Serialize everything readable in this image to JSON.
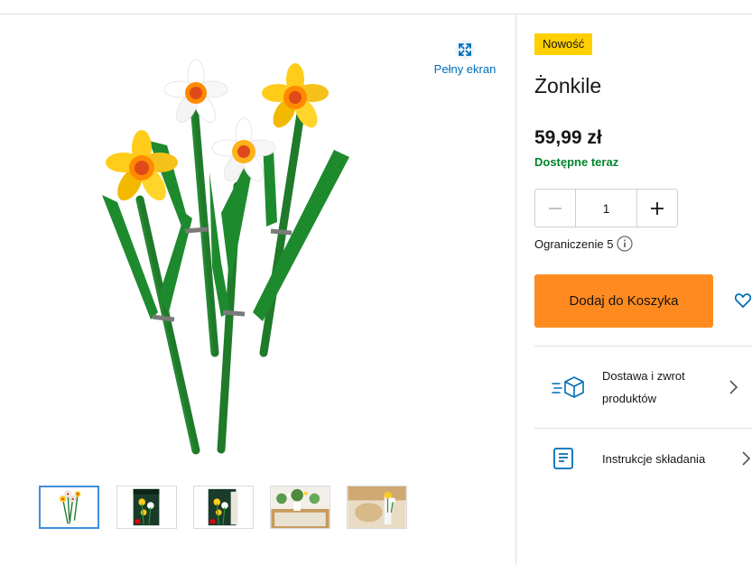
{
  "gallery": {
    "fullscreen_label": "Pełny ekran",
    "thumbnails": [
      {
        "name": "thumbnail-flowers",
        "active": true
      },
      {
        "name": "thumbnail-box-front",
        "active": false
      },
      {
        "name": "thumbnail-box-angle",
        "active": false
      },
      {
        "name": "thumbnail-shelf-scene",
        "active": false
      },
      {
        "name": "thumbnail-table-scene",
        "active": false
      }
    ]
  },
  "product": {
    "badge": "Nowość",
    "title": "Żonkile",
    "price": "59,99 zł",
    "availability": "Dostępne teraz",
    "quantity": "1",
    "limit": "Ograniczenie 5",
    "add_to_cart": "Dodaj do Koszyka"
  },
  "links": {
    "delivery": "Dostawa i zwrot produktów",
    "instructions": "Instrukcje składania"
  },
  "colors": {
    "badge": "#ffcf00",
    "add_to_cart": "#ff8a1f",
    "availability": "#00852b",
    "link": "#006db7",
    "icon": "#006db7",
    "active_thumb": "#3f8ee0"
  }
}
